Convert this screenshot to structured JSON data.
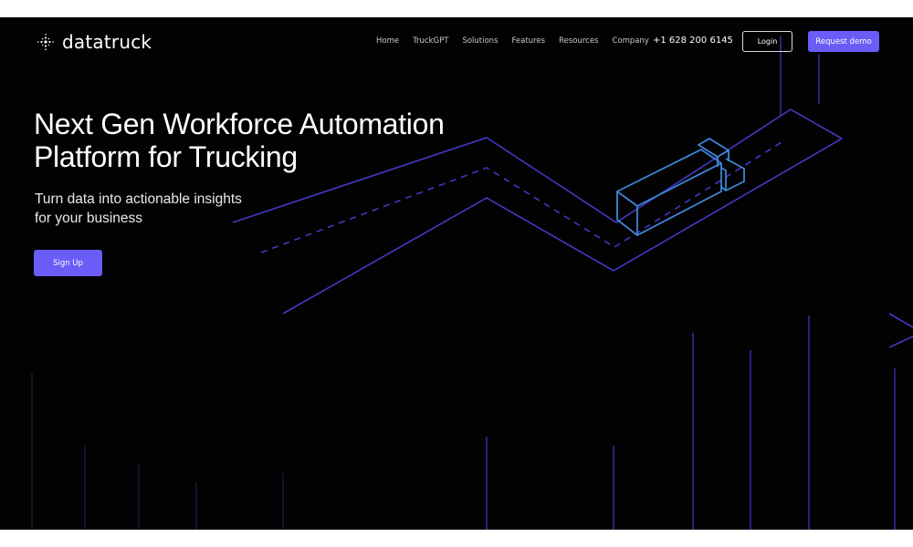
{
  "brand": {
    "name": "datatruck",
    "accent": "#6a5cf6",
    "line_color": "#4a3fd6",
    "truck_color": "#3f86d8"
  },
  "nav": {
    "links": [
      "Home",
      "TruckGPT",
      "Solutions",
      "Features",
      "Resources",
      "Company"
    ],
    "phone": "+1 628 200 6145",
    "login_label": "Login",
    "demo_label": "Request demo"
  },
  "hero": {
    "title_line1": "Next Gen Workforce Automation",
    "title_line2": "Platform for Trucking",
    "subtitle_line1": "Turn data into actionable insights",
    "subtitle_line2": "for your business",
    "cta_label": "Sign Up"
  },
  "icons": {
    "logo": "sparkle-logo-icon"
  }
}
